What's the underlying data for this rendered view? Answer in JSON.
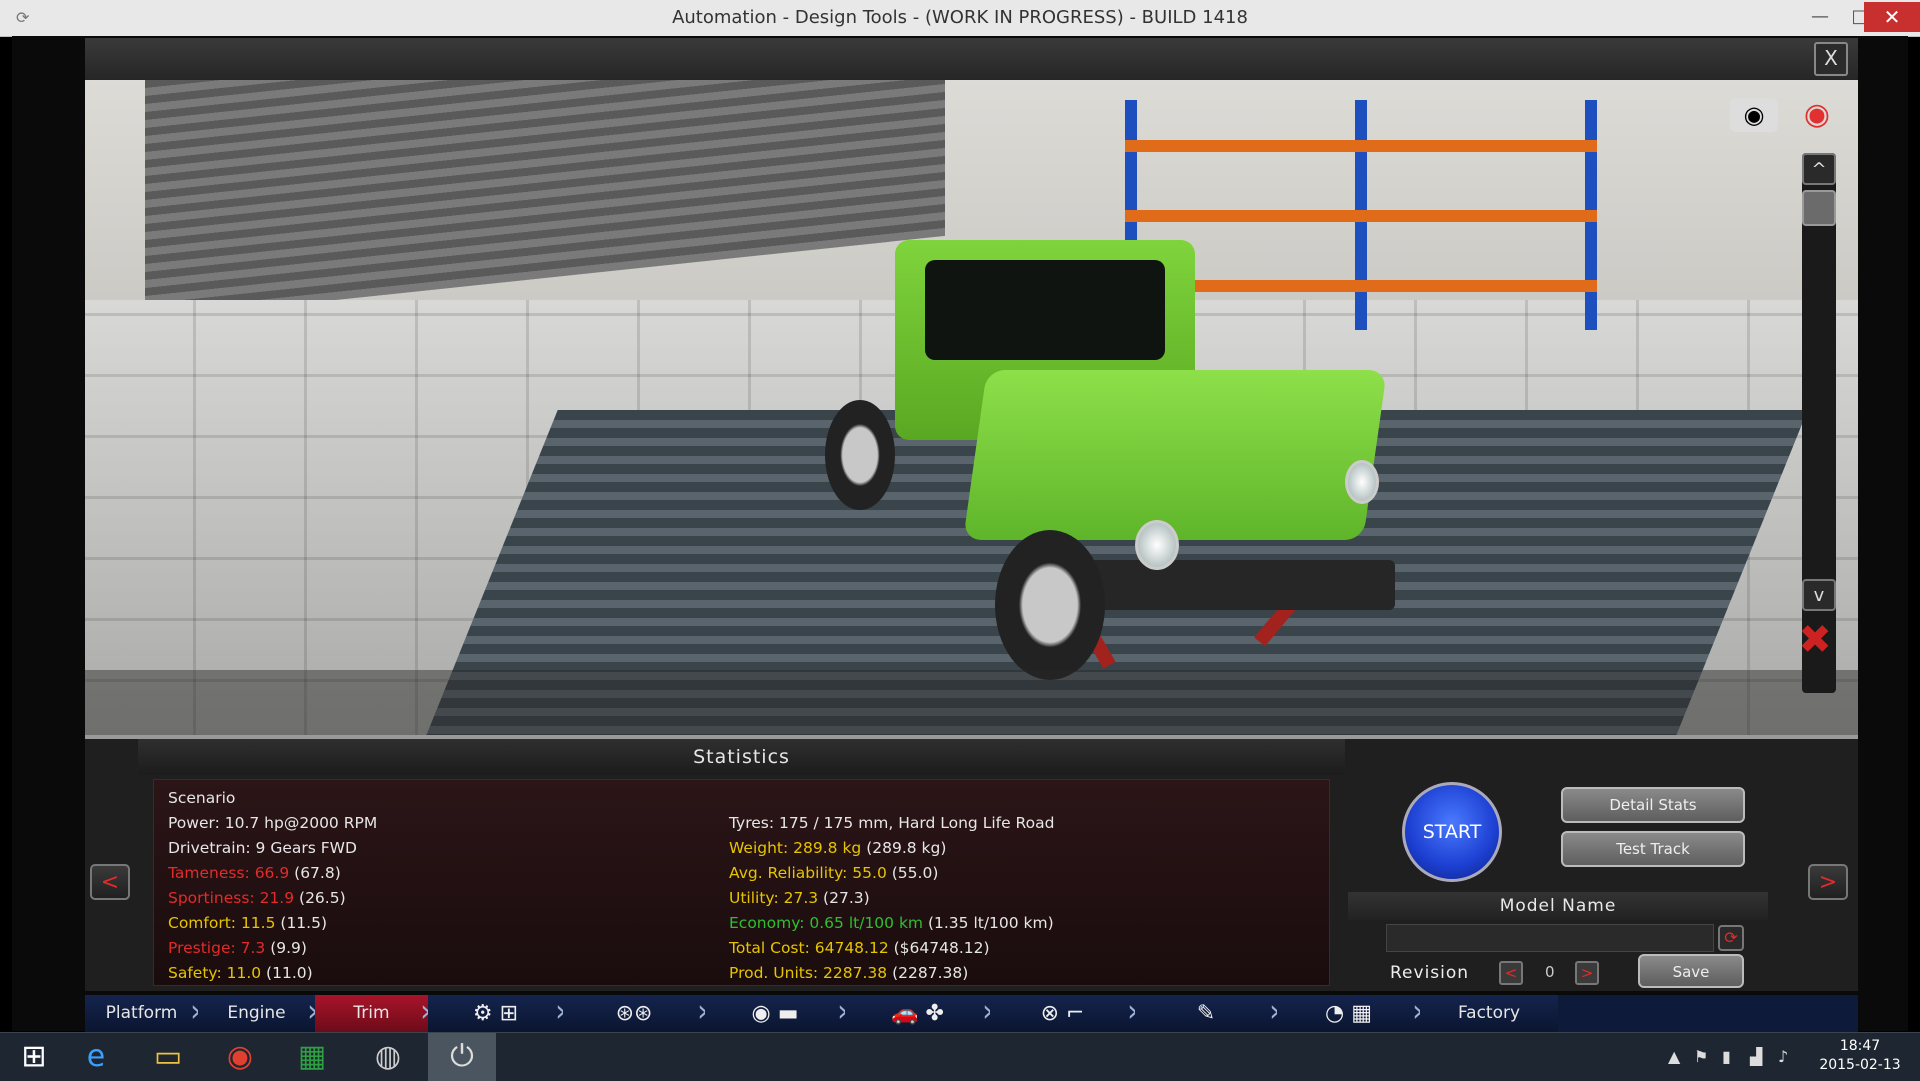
{
  "window": {
    "title": "Automation - Design Tools - (WORK IN PROGRESS) - BUILD 1418",
    "minimize": "—",
    "maximize": "□",
    "close": "✕"
  },
  "game": {
    "close": "X"
  },
  "viewport": {
    "camera_icon": "camera-icon",
    "eye_icon": "eye-icon",
    "scroll_up": "^",
    "scroll_down": "v",
    "hide_camera_icon": "camera-off-icon"
  },
  "statistics": {
    "title": "Statistics",
    "left": [
      {
        "label": "Scenario",
        "value": "",
        "color": "wht"
      },
      {
        "label": "Power: 10.7 hp@2000 RPM",
        "value": "",
        "color": "wht"
      },
      {
        "label": "Drivetrain: 9 Gears FWD",
        "value": "",
        "color": "wht"
      },
      {
        "label": "Tameness: 66.9",
        "value": " (67.8)",
        "color": "red"
      },
      {
        "label": "Sportiness: 21.9",
        "value": " (26.5)",
        "color": "red"
      },
      {
        "label": "Comfort: 11.5",
        "value": " (11.5)",
        "color": "yel"
      },
      {
        "label": "Prestige: 7.3",
        "value": " (9.9)",
        "color": "red"
      },
      {
        "label": "Safety: 11.0",
        "value": " (11.0)",
        "color": "yel"
      }
    ],
    "right": [
      {
        "label": "",
        "value": "",
        "color": "wht"
      },
      {
        "label": "Tyres: 175 / 175 mm, Hard Long Life Road",
        "value": "",
        "color": "wht"
      },
      {
        "label": "Weight: 289.8 kg",
        "value": " (289.8 kg)",
        "color": "yel"
      },
      {
        "label": "Avg. Reliability: 55.0",
        "value": " (55.0)",
        "color": "yel"
      },
      {
        "label": "Utility: 27.3",
        "value": " (27.3)",
        "color": "yel"
      },
      {
        "label": "Economy: 0.65 lt/100 km",
        "value": " (1.35 lt/100 km)",
        "color": "grn"
      },
      {
        "label": "Total Cost: 64748.12",
        "value": " ($64748.12)",
        "color": "yel"
      },
      {
        "label": "Prod. Units: 2287.38",
        "value": " (2287.38)",
        "color": "yel"
      }
    ]
  },
  "controls": {
    "prev": "<",
    "next": ">",
    "start": "START",
    "detail_stats": "Detail Stats",
    "test_track": "Test Track",
    "model_name_label": "Model Name",
    "model_name_value": "",
    "revision_label": "Revision",
    "revision_value": "0",
    "rev_prev": "<",
    "rev_next": ">",
    "save": "Save"
  },
  "tabs": [
    {
      "label": "Platform",
      "type": "text"
    },
    {
      "label": "Engine",
      "type": "text"
    },
    {
      "label": "Trim",
      "type": "text",
      "active": true
    },
    {
      "label": "⚙ ⊞",
      "type": "icon",
      "icon": "gearbox-icon"
    },
    {
      "label": "⊛⊛",
      "type": "icon",
      "icon": "wheels-icon"
    },
    {
      "label": "◉ ▬",
      "type": "icon",
      "icon": "suspension-icon"
    },
    {
      "label": "🚗 ✤",
      "type": "icon",
      "icon": "car-body-icon"
    },
    {
      "label": "⊗ ⌐",
      "type": "icon",
      "icon": "interior-icon"
    },
    {
      "label": "✎",
      "type": "icon",
      "icon": "paint-icon"
    },
    {
      "label": "◔ ▦",
      "type": "icon",
      "icon": "testing-icon"
    },
    {
      "label": "Factory",
      "type": "text"
    }
  ],
  "taskbar": {
    "start_icon": "windows-start-icon",
    "apps": [
      "internet-explorer-icon",
      "file-explorer-icon",
      "chrome-icon",
      "store-icon",
      "steam-icon",
      "automation-game-icon"
    ],
    "clock_time": "18:47",
    "clock_date": "2015-02-13"
  }
}
